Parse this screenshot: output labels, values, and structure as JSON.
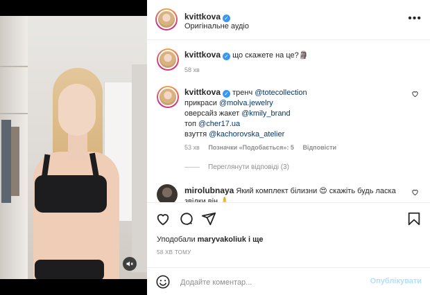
{
  "post": {
    "username": "kvittkova",
    "audio": "Оригінальне аудіо"
  },
  "comments": [
    {
      "username": "kvittkova",
      "text": "що скажете на це?🗿",
      "time": "58 хв"
    },
    {
      "username": "kvittkova",
      "lines": [
        {
          "prefix": "тренч ",
          "mention": "@totecollection"
        },
        {
          "prefix": "прикраси ",
          "mention": "@molva.jewelry"
        },
        {
          "prefix": "оверсайз жакет ",
          "mention": "@kmily_brand"
        },
        {
          "prefix": "топ ",
          "mention": "@cher17.ua"
        },
        {
          "prefix": "взуття ",
          "mention": "@kachorovska_atelier"
        }
      ],
      "time": "53 хв",
      "likes": "Позначки «Подобається»: 5",
      "reply": "Відповісти",
      "view_replies": "Переглянути відповіді (3)"
    },
    {
      "username": "mirolubnaya",
      "text": "Який комплект білизни 😍 скажіть будь ласка",
      "text2": "звідки він 🙏"
    }
  ],
  "likes_text": {
    "prefix": "Уподобали ",
    "user": "maryvakoliuk",
    "suffix": " і ще"
  },
  "time_ago": "58 ХВ ТОМУ",
  "composer": {
    "placeholder": "Додайте коментар...",
    "publish": "Опублікувати"
  },
  "icons": {
    "like": "heart-icon",
    "comment": "comment-icon",
    "share": "share-icon",
    "save": "bookmark-icon",
    "emoji": "emoji-icon",
    "mute": "muted-speaker-icon"
  }
}
